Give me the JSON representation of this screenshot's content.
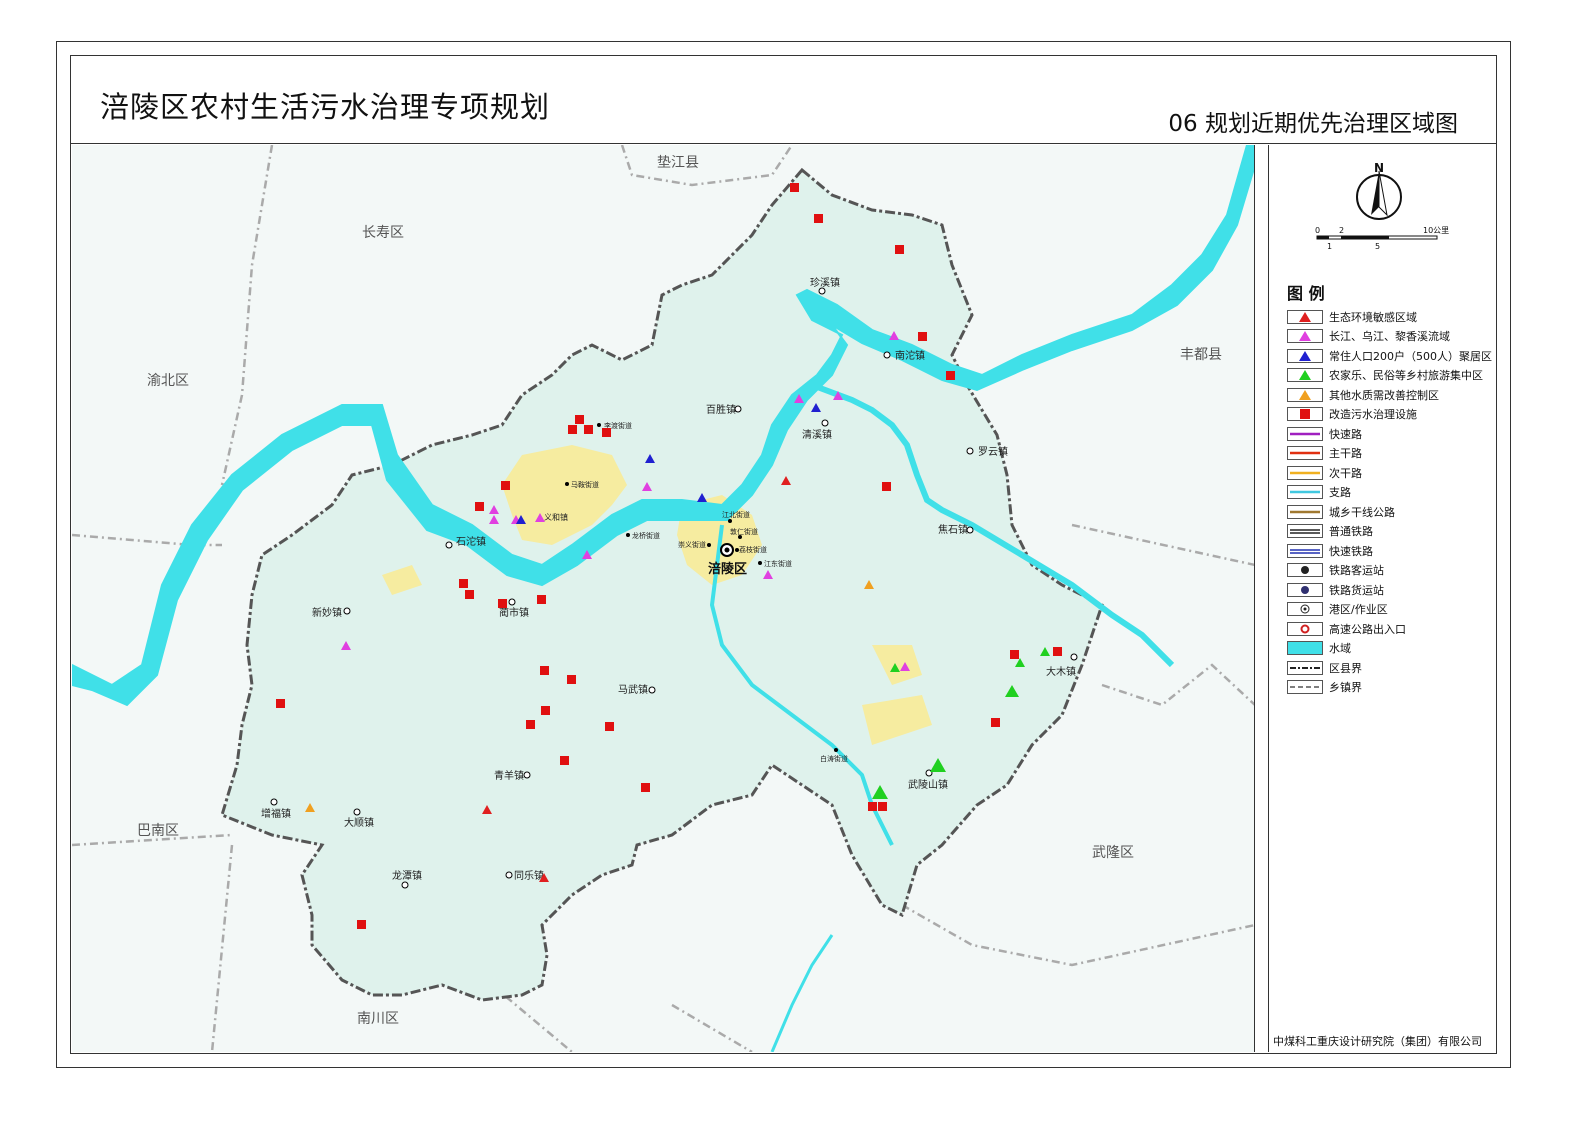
{
  "header": {
    "title": "涪陵区农村生活污水治理专项规划",
    "subtitle": "06 规划近期优先治理区域图"
  },
  "compass": {
    "north_label": "N",
    "scale_top": [
      "0",
      "2",
      "10公里"
    ],
    "scale_bottom": [
      "1",
      "5"
    ]
  },
  "legend": {
    "title": "图 例",
    "items": [
      {
        "label": "生态环境敏感区域",
        "symbol": "triangle",
        "color": "#e02020"
      },
      {
        "label": "长江、乌江、黎香溪流域",
        "symbol": "triangle",
        "color": "#e040e0"
      },
      {
        "label": "常住人口200户（500人）聚居区",
        "symbol": "triangle",
        "color": "#2020d0"
      },
      {
        "label": "农家乐、民俗等乡村旅游集中区",
        "symbol": "triangle",
        "color": "#20d020"
      },
      {
        "label": "其他水质需改善控制区",
        "symbol": "triangle",
        "color": "#f0a020"
      },
      {
        "label": "改造污水治理设施",
        "symbol": "square",
        "color": "#e01010"
      },
      {
        "label": "快速路",
        "symbol": "line",
        "color": "#a020c0"
      },
      {
        "label": "主干路",
        "symbol": "line",
        "color": "#e03010"
      },
      {
        "label": "次干路",
        "symbol": "line",
        "color": "#f0b020"
      },
      {
        "label": "支路",
        "symbol": "line",
        "color": "#40c8e0"
      },
      {
        "label": "城乡干线公路",
        "symbol": "line",
        "color": "#a07830"
      },
      {
        "label": "普通铁路",
        "symbol": "rail",
        "color": "#222222"
      },
      {
        "label": "快速铁路",
        "symbol": "rail",
        "color": "#2030b0"
      },
      {
        "label": "铁路客运站",
        "symbol": "dot",
        "color": "#222222"
      },
      {
        "label": "铁路货运站",
        "symbol": "dot",
        "color": "#303070"
      },
      {
        "label": "港区/作业区",
        "symbol": "port",
        "color": "#222222"
      },
      {
        "label": "高速公路出入口",
        "symbol": "ring",
        "color": "#d02020"
      },
      {
        "label": "水域",
        "symbol": "fill",
        "color": "#40e0e8"
      },
      {
        "label": "区县界",
        "symbol": "dashdot",
        "color": "#222222"
      },
      {
        "label": "乡镇界",
        "symbol": "dash",
        "color": "#555555"
      }
    ]
  },
  "company": "中煤科工重庆设计研究院（集团）有限公司",
  "map": {
    "neighbors": [
      "垫江县",
      "长寿区",
      "渝北区",
      "丰都县",
      "巴南区",
      "武隆区",
      "南川区"
    ],
    "center": "涪陵区",
    "towns": [
      "珍溪镇",
      "南沱镇",
      "百胜镇",
      "清溪镇",
      "罗云镇",
      "焦石镇",
      "李渡街道",
      "马鞍街道",
      "义和镇",
      "龙桥街道",
      "江北街道",
      "敦仁街道",
      "崇义街道",
      "荔枝街道",
      "江东街道",
      "石沱镇",
      "新妙镇",
      "蔺市镇",
      "马武镇",
      "大木镇",
      "白涛街道",
      "武陵山镇",
      "青羊镇",
      "增福镇",
      "大顺镇",
      "龙潭镇",
      "同乐镇"
    ]
  },
  "colors": {
    "district_fill": "#dff2ec",
    "outside_fill": "#f3f8f7",
    "water": "#40e0e8",
    "urban": "#f6eca0",
    "boundary": "#555555"
  }
}
